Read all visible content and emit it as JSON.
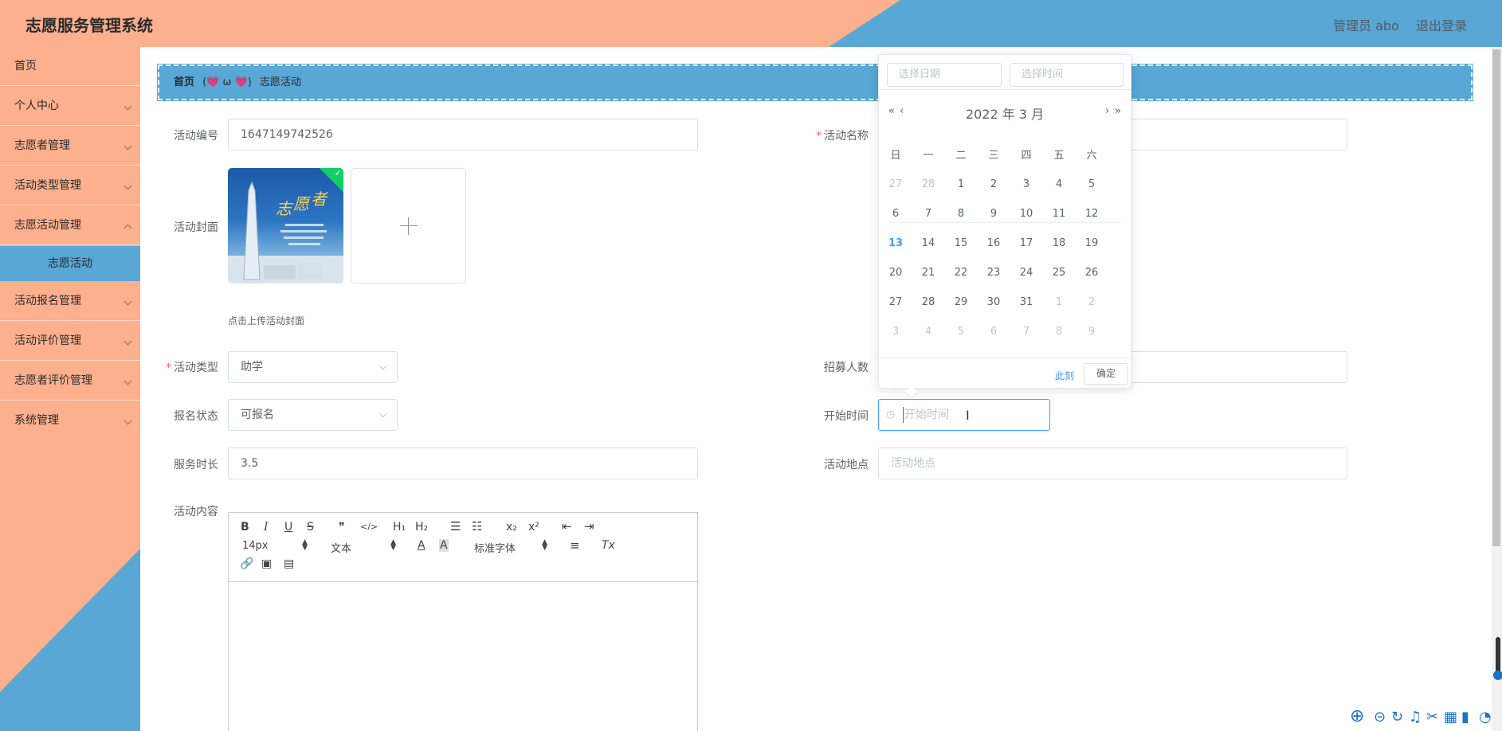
{
  "header": {
    "title": "志愿服务管理系统",
    "user": "管理员 abo",
    "logout": "退出登录"
  },
  "sidebar": {
    "items": [
      {
        "label": "首页"
      },
      {
        "label": "个人中心"
      },
      {
        "label": "志愿者管理"
      },
      {
        "label": "活动类型管理"
      },
      {
        "label": "志愿活动管理"
      },
      {
        "label": "活动报名管理"
      },
      {
        "label": "活动评价管理"
      },
      {
        "label": "志愿者评价管理"
      },
      {
        "label": "系统管理"
      }
    ],
    "active_sub": "志愿活动"
  },
  "breadcrumb": {
    "home": "首页",
    "separator": "(💗 ω 💗)",
    "current": "志愿活动"
  },
  "form": {
    "activity_id_label": "活动编号",
    "activity_id_value": "1647149742526",
    "activity_name_label": "活动名称",
    "cover_label": "活动封面",
    "cover_tip": "点击上传活动封面",
    "type_label": "活动类型",
    "type_value": "助学",
    "recruit_label": "招募人数",
    "status_label": "报名状态",
    "status_value": "可报名",
    "start_label": "开始时间",
    "start_placeholder": "开始时间",
    "duration_label": "服务时长",
    "duration_value": "3.5",
    "location_label": "活动地点",
    "location_placeholder": "活动地点",
    "content_label": "活动内容"
  },
  "editor": {
    "font_size": "14px",
    "paragraph": "文本",
    "font_family": "标准字体",
    "bold": "B",
    "italic": "I",
    "underline": "U",
    "strike": "S",
    "quote": "❞",
    "code": "</>",
    "h1": "H₁",
    "h2": "H₂",
    "sub": "x₂",
    "sup": "x²",
    "color": "A",
    "bg_color": "A",
    "clear": "Tx"
  },
  "datepicker": {
    "date_placeholder": "选择日期",
    "time_placeholder": "选择时间",
    "title": "2022 年  3 月",
    "prev_year": "«",
    "prev_month": "‹",
    "next_month": "›",
    "next_year": "»",
    "weekdays": [
      "日",
      "一",
      "二",
      "三",
      "四",
      "五",
      "六"
    ],
    "today_btn": "此刻",
    "ok_btn": "确定",
    "today_day": "13",
    "rows": [
      [
        "27",
        "28",
        "1",
        "2",
        "3",
        "4",
        "5"
      ],
      [
        "6",
        "7",
        "8",
        "9",
        "10",
        "11",
        "12"
      ],
      [
        "13",
        "14",
        "15",
        "16",
        "17",
        "18",
        "19"
      ],
      [
        "20",
        "21",
        "22",
        "23",
        "24",
        "25",
        "26"
      ],
      [
        "27",
        "28",
        "29",
        "30",
        "31",
        "1",
        "2"
      ],
      [
        "3",
        "4",
        "5",
        "6",
        "7",
        "8",
        "9"
      ]
    ]
  },
  "colors": {
    "header_salmon": "#fdb08e",
    "header_blue": "#58a7d4",
    "accent": "#409eff"
  }
}
